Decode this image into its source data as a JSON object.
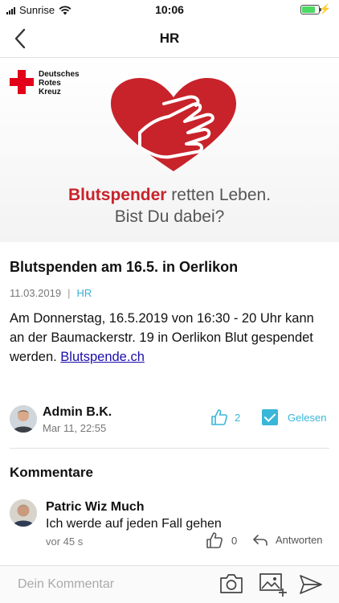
{
  "status_bar": {
    "carrier": "Sunrise",
    "time": "10:06",
    "battery_level": 0.8
  },
  "nav": {
    "title": "HR"
  },
  "banner": {
    "org_name_lines": [
      "Deutsches",
      "Rotes",
      "Kreuz"
    ],
    "slogan_bold": "Blutspender",
    "slogan_rest": " retten Leben.",
    "slogan_line2": "Bist Du dabei?"
  },
  "article": {
    "title": "Blutspenden am 16.5. in Oerlikon",
    "date": "11.03.2019",
    "separator": "|",
    "category": "HR",
    "body": "Am Donnerstag, 16.5.2019 von 16:30 - 20 Uhr kann an der Baumackerstr. 19 in Oerlikon Blut gespendet werden. ",
    "link_text": "Blutspende.ch"
  },
  "author": {
    "name": "Admin B.K.",
    "date": "Mar 11, 22:55",
    "likes": "2",
    "read_label": "Gelesen"
  },
  "comments": {
    "title": "Kommentare",
    "items": [
      {
        "name": "Patric Wiz Much",
        "text": "Ich werde auf jeden Fall gehen",
        "time": "vor 45 s",
        "likes": "0",
        "reply_label": "Antworten"
      }
    ]
  },
  "compose": {
    "placeholder": "Dein Kommentar"
  },
  "colors": {
    "accent": "#3ab6d8",
    "brand_red": "#c8232b",
    "link": "#1a0dab"
  }
}
